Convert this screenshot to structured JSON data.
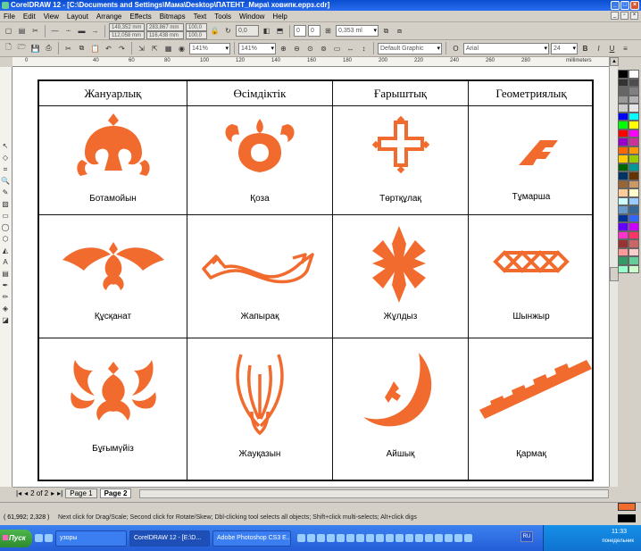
{
  "window": {
    "title": "CorelDRAW 12 - [C:\\Documents and Settings\\Мама\\Desktop\\ПАТЕНТ_Мира\\ ховипк.еррз.cdr]"
  },
  "menu": [
    "File",
    "Edit",
    "View",
    "Layout",
    "Arrange",
    "Effects",
    "Bitmaps",
    "Text",
    "Tools",
    "Window",
    "Help"
  ],
  "toolbar1": {
    "x_pos": "149,352 mm",
    "y_pos": "112,058 mm",
    "width": "283,867 mm",
    "height": "116,438 mm",
    "scale_x": "100,0",
    "scale_y": "100,0",
    "angle": "0,0",
    "outline": "0,353 ml"
  },
  "toolbar2": {
    "zoom1": "141%",
    "zoom2": "141%",
    "style": "Default Graphic",
    "font": "Arial",
    "size": "24"
  },
  "ruler": {
    "unit": "millimeters",
    "h_ticks": [
      "0",
      "40",
      "60",
      "80",
      "100",
      "120",
      "140",
      "160",
      "180",
      "200",
      "220",
      "240",
      "260",
      "280"
    ]
  },
  "table": {
    "headers": [
      "Жануарлық",
      "Өсімдіктік",
      "Ғарыштық",
      "Геометриялық"
    ],
    "rows": [
      [
        "Ботамойын",
        "Қоза",
        "Төртқұлақ",
        "Тұмарша"
      ],
      [
        "Құсқанат",
        "Жапырақ",
        "Жұлдыз",
        "Шынжыр"
      ],
      [
        "Бұғымүйіз",
        "Жауқазын",
        "Айшық",
        "Қармақ"
      ]
    ]
  },
  "pages": {
    "indicator": "2 of 2",
    "tabs": [
      "Page 1",
      "Page 2"
    ],
    "active": "Page 2"
  },
  "status": {
    "coords": "( 61,992; 2,328 )",
    "hint": "Next click for Drag/Scale; Second click for Rotate/Skew; Dbl-clicking tool selects all objects; Shift+click multi-selects; Alt+click digs"
  },
  "taskbar": {
    "start": "Пуск",
    "tasks": [
      "узоры",
      "CorelDRAW 12 - [E:\\D...",
      "Adobe Photoshop CS3 E..."
    ],
    "lang": "RU",
    "time": "11:33",
    "day": "понедельник"
  },
  "colors": {
    "ornament": "#f26b2e",
    "fill": "#f26b2e",
    "outline": "#000000"
  },
  "palette": [
    "#000000",
    "#ffffff",
    "#333333",
    "#4d4d4d",
    "#666666",
    "#808080",
    "#999999",
    "#b3b3b3",
    "#cccccc",
    "#e6e6e6",
    "#0000ff",
    "#00ffff",
    "#00ff00",
    "#ffff00",
    "#ff0000",
    "#ff00ff",
    "#9900cc",
    "#cc3399",
    "#ff6600",
    "#ff9900",
    "#ffcc00",
    "#99cc00",
    "#006600",
    "#009999",
    "#003366",
    "#663300",
    "#996633",
    "#cc9966",
    "#ffcc99",
    "#ffffcc",
    "#ccffff",
    "#99ccff",
    "#6699cc",
    "#336699",
    "#003399",
    "#3366ff",
    "#6600ff",
    "#cc00ff",
    "#ff33cc",
    "#ff3366",
    "#993333",
    "#cc6666",
    "#ff9999",
    "#ffcccc",
    "#339966",
    "#66cc99",
    "#99ffcc",
    "#ccffcc"
  ]
}
